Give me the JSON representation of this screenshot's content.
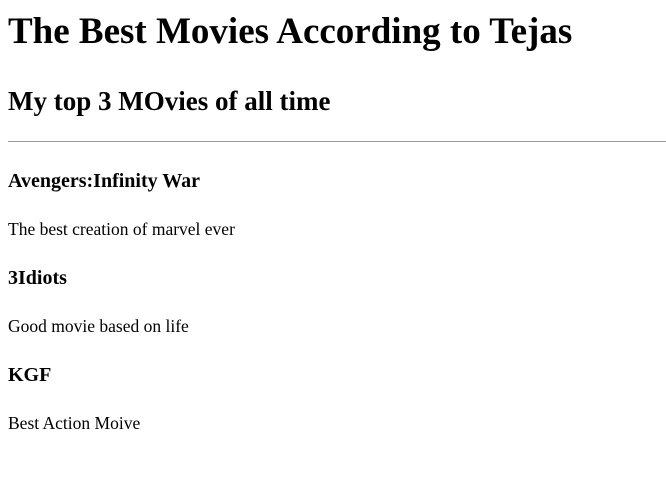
{
  "page": {
    "title": "The Best Movies According to Tejas",
    "subtitle": "My top 3 MOvies of all time"
  },
  "movies": [
    {
      "title": "Avengers:Infinity War",
      "description": "The best creation of marvel ever"
    },
    {
      "title": "3Idiots",
      "description": "Good movie based on life"
    },
    {
      "title": "KGF",
      "description": "Best Action Moive"
    }
  ]
}
